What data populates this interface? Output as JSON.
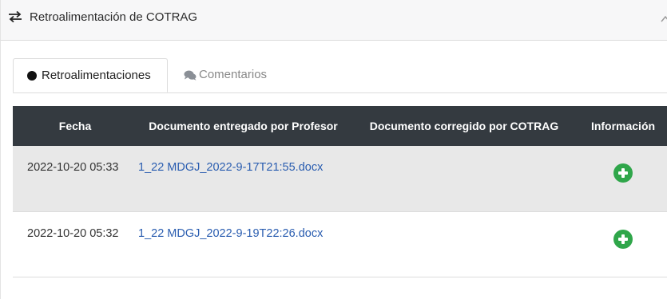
{
  "panel": {
    "title": "Retroalimentación de COTRAG",
    "title_icon": "swap-arrows-icon",
    "collapse_icon": "chevron-up-icon"
  },
  "tabs": [
    {
      "label": "Retroalimentaciones",
      "icon": "circle-icon",
      "active": true
    },
    {
      "label": "Comentarios",
      "icon": "comments-icon",
      "active": false
    }
  ],
  "table": {
    "columns": [
      "Fecha",
      "Documento entregado por Profesor",
      "Documento corregido por COTRAG",
      "Información"
    ],
    "rows": [
      {
        "fecha": "2022-10-20 05:33",
        "documento_profesor": "1_22 MDGJ_2022-9-17T21:55.docx",
        "documento_cotrag": "",
        "info_icon": "plus-circle-icon"
      },
      {
        "fecha": "2022-10-20 05:32",
        "documento_profesor": "1_22 MDGJ_2022-9-19T22:26.docx",
        "documento_cotrag": "",
        "info_icon": "plus-circle-icon"
      }
    ]
  },
  "colors": {
    "header_bg": "#343a40",
    "link": "#2a5db0",
    "plus_icon": "#2fa64a"
  }
}
